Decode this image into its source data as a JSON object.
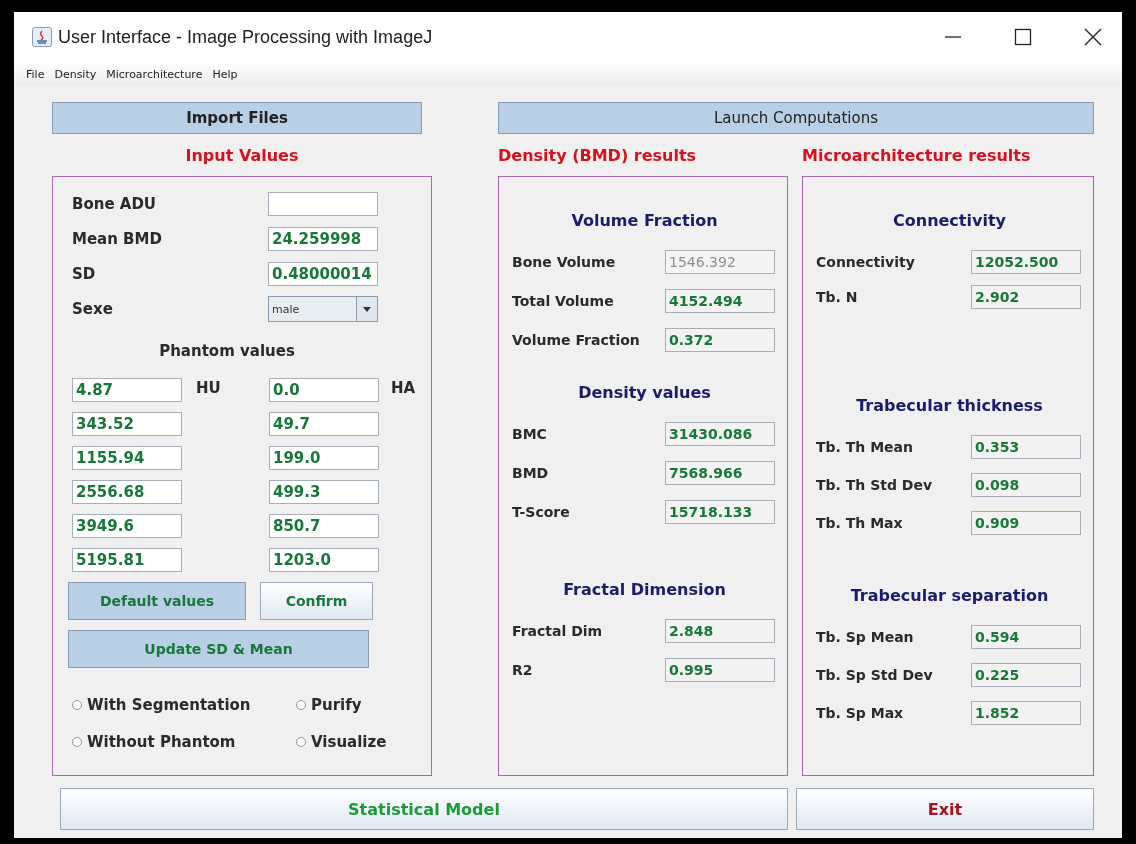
{
  "window": {
    "title": "User Interface - Image Processing with ImageJ"
  },
  "menu": [
    {
      "label": "File"
    },
    {
      "label": "Density"
    },
    {
      "label": "Microarchitecture"
    },
    {
      "label": "Help"
    }
  ],
  "input_panel": {
    "import_button": {
      "label": "Import Files",
      "highlighted": true
    },
    "heading": "Input Values",
    "fields": [
      {
        "kind": "text",
        "label": "Bone ADU"
      },
      {
        "kind": "text",
        "label": "Mean BMD",
        "value": "24.259998"
      },
      {
        "kind": "text",
        "label": "SD",
        "value": "0.48000014"
      },
      {
        "kind": "dropdown",
        "label": "Sexe",
        "value": "male"
      }
    ],
    "phantom": {
      "heading": "Phantom values",
      "units": [
        "HU",
        "HA"
      ],
      "rows": [
        {
          "hu": "4.87",
          "ha": "0.0"
        },
        {
          "hu": "343.52",
          "ha": "49.7"
        },
        {
          "hu": "1155.94",
          "ha": "199.0"
        },
        {
          "hu": "2556.68",
          "ha": "499.3"
        },
        {
          "hu": "3949.6",
          "ha": "850.7"
        },
        {
          "hu": "5195.81",
          "ha": "1203.0"
        }
      ]
    },
    "buttons": [
      {
        "label": "Default values",
        "highlighted": true
      },
      {
        "label": "Confirm",
        "highlighted": false
      },
      {
        "label": "Update SD & Mean",
        "highlighted": true
      }
    ],
    "options": [
      {
        "label": "With Segmentation",
        "checked": false
      },
      {
        "label": "Purify",
        "checked": false
      },
      {
        "label": "Without Phantom",
        "checked": false
      },
      {
        "label": "Visualize",
        "checked": false
      }
    ]
  },
  "launch_button": {
    "label": "Launch Computations",
    "highlighted": true
  },
  "density_panel": {
    "heading": "Density (BMD) results",
    "sections": [
      {
        "title": "Volume Fraction",
        "fields": [
          {
            "label": "Bone Volume",
            "value": "1546.392",
            "disabled": true
          },
          {
            "label": "Total Volume",
            "value": "4152.494",
            "disabled": false
          },
          {
            "label": "Volume Fraction",
            "value": "0.372",
            "disabled": false
          }
        ]
      },
      {
        "title": "Density values",
        "fields": [
          {
            "label": "BMC",
            "value": "31430.086",
            "disabled": false
          },
          {
            "label": "BMD",
            "value": "7568.966",
            "disabled": false
          },
          {
            "label": "T-Score",
            "value": "15718.133",
            "disabled": false
          }
        ]
      },
      {
        "title": "Fractal Dimension",
        "fields": [
          {
            "label": "Fractal Dim",
            "value": "2.848",
            "disabled": false
          },
          {
            "label": "R2",
            "value": "0.995",
            "disabled": false
          }
        ]
      }
    ]
  },
  "micro_panel": {
    "heading": "Microarchitecture results",
    "sections": [
      {
        "title": "Connectivity",
        "fields": [
          {
            "label": "Connectivity",
            "value": "12052.500",
            "disabled": false
          },
          {
            "label": "Tb. N",
            "value": "2.902",
            "disabled": false
          }
        ]
      },
      {
        "title": "Trabecular thickness",
        "fields": [
          {
            "label": "Tb. Th Mean",
            "value": "0.353",
            "disabled": false
          },
          {
            "label": "Tb. Th Std Dev",
            "value": "0.098",
            "disabled": false
          },
          {
            "label": "Tb. Th Max",
            "value": "0.909",
            "disabled": false
          }
        ]
      },
      {
        "title": "Trabecular separation",
        "fields": [
          {
            "label": "Tb. Sp Mean",
            "value": "0.594",
            "disabled": false
          },
          {
            "label": "Tb. Sp Std Dev",
            "value": "0.225",
            "disabled": false
          },
          {
            "label": "Tb. Sp Max",
            "value": "1.852",
            "disabled": false
          }
        ]
      }
    ]
  },
  "bottom_buttons": [
    {
      "kind": "model",
      "label": "Statistical Model",
      "highlighted": false
    },
    {
      "kind": "exit",
      "label": "Exit",
      "highlighted": false
    }
  ]
}
